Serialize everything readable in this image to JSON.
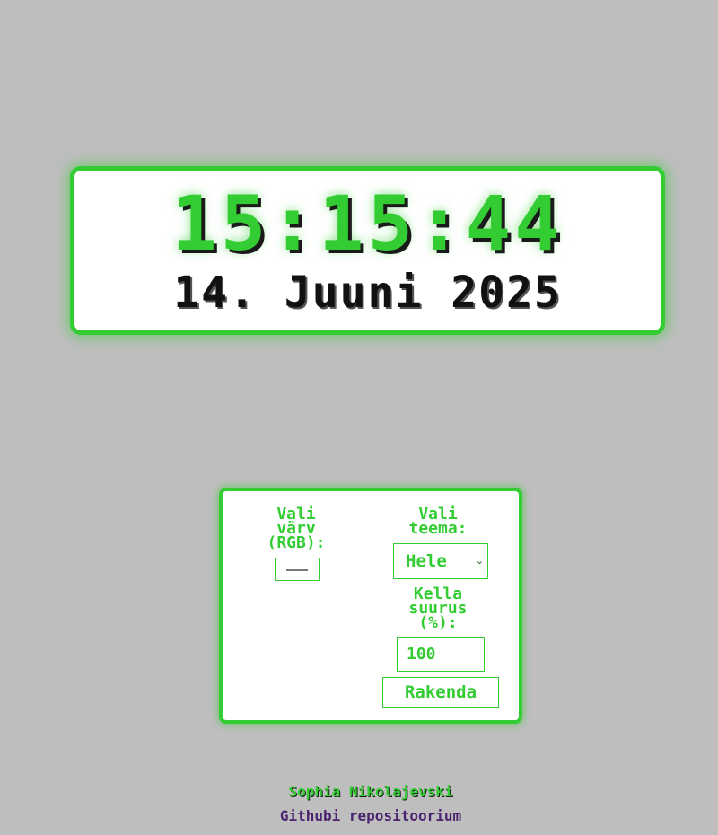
{
  "clock": {
    "time": "15:15:44",
    "date": "14. Juuni 2025"
  },
  "settings": {
    "color_label": "Vali värv (RGB):",
    "theme_label": "Vali teema:",
    "theme_selected": "Hele",
    "size_label": "Kella suurus (%):",
    "size_value": "100",
    "apply_label": "Rakenda"
  },
  "footer": {
    "author": "Sophia Nikolajevski",
    "repo_link": "Githubi repositoorium"
  },
  "colors": {
    "accent": "#33cc33",
    "background": "#bebebe",
    "panel": "#ffffff",
    "link": "#4b2270"
  },
  "icons": {
    "theme_dropdown": "chevron-down-icon"
  }
}
